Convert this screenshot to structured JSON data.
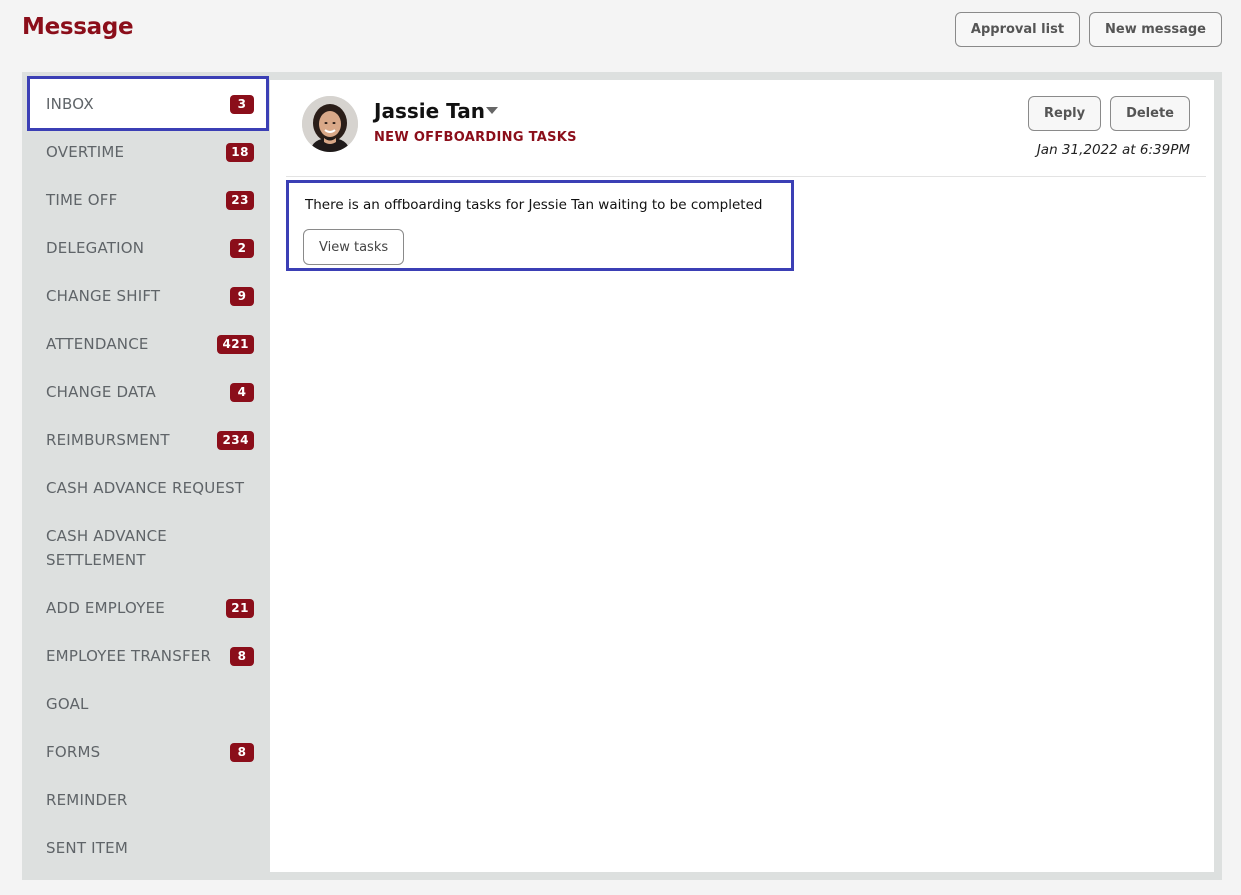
{
  "header": {
    "title": "Message",
    "approval_list_label": "Approval list",
    "new_message_label": "New message"
  },
  "sidebar": {
    "items": [
      {
        "label": "INBOX",
        "count": "3"
      },
      {
        "label": "OVERTIME",
        "count": "18"
      },
      {
        "label": "TIME OFF",
        "count": "23"
      },
      {
        "label": "DELEGATION",
        "count": "2"
      },
      {
        "label": "CHANGE SHIFT",
        "count": "9"
      },
      {
        "label": "ATTENDANCE",
        "count": "421"
      },
      {
        "label": "CHANGE DATA",
        "count": "4"
      },
      {
        "label": "REIMBURSMENT",
        "count": "234"
      },
      {
        "label": "CASH ADVANCE REQUEST",
        "count": ""
      },
      {
        "label": "CASH ADVANCE SETTLEMENT",
        "count": ""
      },
      {
        "label": "ADD EMPLOYEE",
        "count": "21"
      },
      {
        "label": "EMPLOYEE TRANSFER",
        "count": "8"
      },
      {
        "label": "GOAL",
        "count": ""
      },
      {
        "label": "FORMS",
        "count": "8"
      },
      {
        "label": "REMINDER",
        "count": ""
      },
      {
        "label": "SENT ITEM",
        "count": ""
      }
    ],
    "active_index": 0
  },
  "message": {
    "sender_name": "Jassie Tan",
    "subject": "NEW OFFBOARDING TASKS",
    "reply_label": "Reply",
    "delete_label": "Delete",
    "timestamp": "Jan 31,2022 at 6:39PM",
    "body": "There is an offboarding tasks for Jessie Tan waiting to be completed",
    "view_tasks_label": "View tasks"
  },
  "colors": {
    "brand": "#8b0e1a",
    "highlight": "#3b3fb5",
    "sidebar_bg": "#dde0df"
  }
}
